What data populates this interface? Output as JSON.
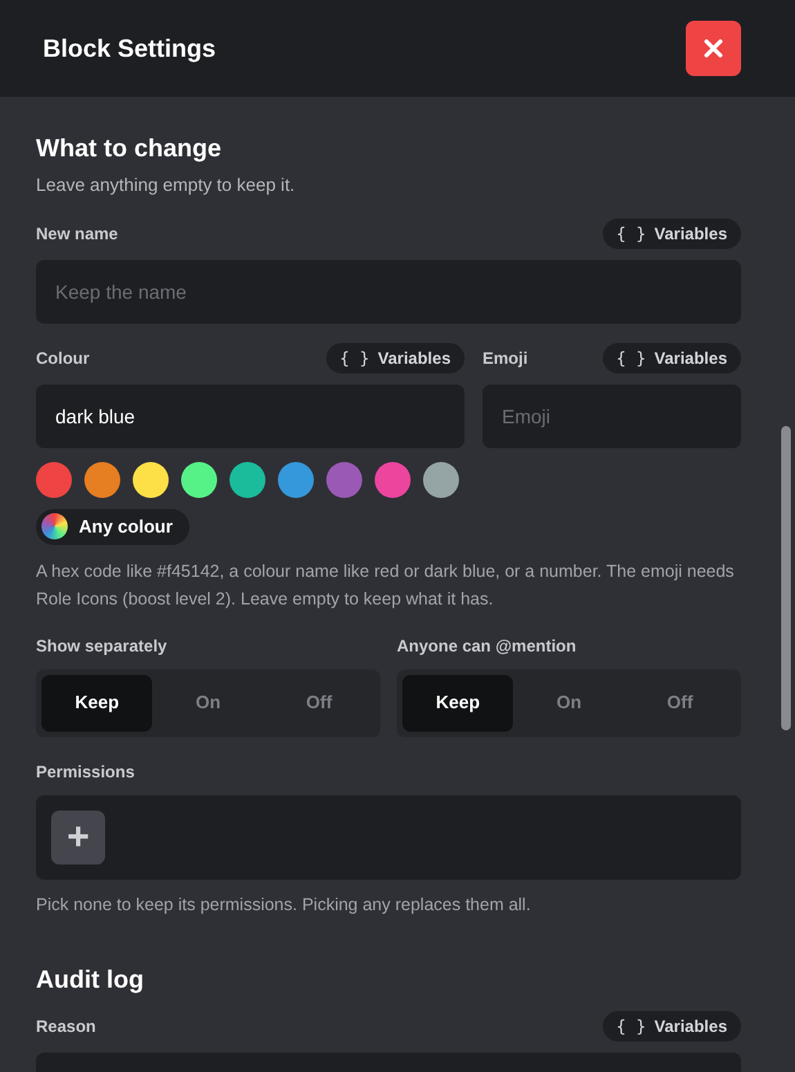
{
  "window": {
    "title": "Block Settings"
  },
  "sections": [
    {
      "heading": "What to change",
      "description": "Leave anything empty to keep it."
    },
    {
      "heading": "Audit log"
    }
  ],
  "new_name": {
    "label": "New name",
    "variables": {
      "braces": "{ }",
      "label": "Variables"
    },
    "placeholder": "Keep the name"
  },
  "colour": {
    "label": "Colour",
    "variables": {
      "braces": "{ }",
      "label": "Variables"
    },
    "value": "dark blue"
  },
  "emoji": {
    "label": "Emoji",
    "variables": {
      "braces": "{ }",
      "label": "Variables"
    },
    "placeholder": "Emoji"
  },
  "swatches": [
    {
      "color": "#ef4444"
    },
    {
      "color": "#e67e22"
    },
    {
      "color": "#fde047"
    },
    {
      "color": "#57f287"
    },
    {
      "color": "#1abc9c"
    },
    {
      "color": "#3498db"
    },
    {
      "color": "#9b59b6"
    },
    {
      "color": "#eb459e"
    },
    {
      "color": "#95a5a6"
    }
  ],
  "any_colour": "Any colour",
  "colour_help": "A hex code like #f45142, a colour name like red or dark blue, or a number. The emoji needs Role Icons (boost level 2). Leave empty to keep what it has.",
  "toggles": [
    {
      "label": "Show separately",
      "options": [
        {
          "label": "Keep",
          "selected": true
        },
        {
          "label": "On",
          "selected": false
        },
        {
          "label": "Off",
          "selected": false
        }
      ]
    },
    {
      "label": "Anyone can @mention",
      "options": [
        {
          "label": "Keep",
          "selected": true
        },
        {
          "label": "On",
          "selected": false
        },
        {
          "label": "Off",
          "selected": false
        }
      ]
    }
  ],
  "permissions": {
    "label": "Permissions",
    "add_button": "+",
    "help": "Pick none to keep its permissions. Picking any replaces them all."
  },
  "reason": {
    "label": "Reason",
    "variables": {
      "braces": "{ }",
      "label": "Variables"
    }
  }
}
